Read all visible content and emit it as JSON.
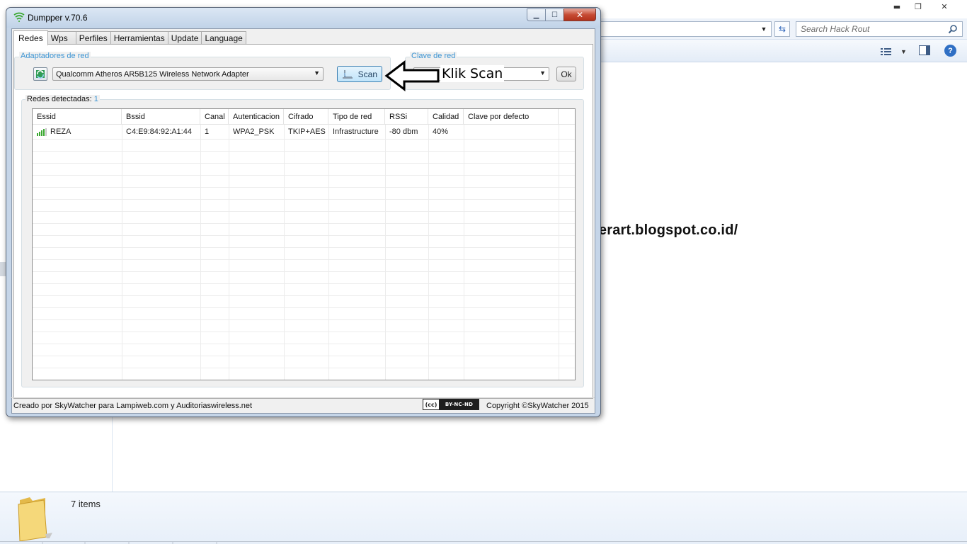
{
  "explorer": {
    "search_placeholder": "Search Hack Rout",
    "items_count": "7 items",
    "win_minimize": "▬",
    "win_restore": "❐",
    "win_close": "✕"
  },
  "watermark": "http://tkjcyberart.blogspot.co.id/",
  "dumpper": {
    "title": "Dumpper v.70.6",
    "tabs": [
      {
        "label": "Redes",
        "active": true
      },
      {
        "label": "Wps"
      },
      {
        "label": "Perfiles"
      },
      {
        "label": "Herramientas"
      },
      {
        "label": "Update"
      },
      {
        "label": "Language"
      }
    ],
    "adapters_group_label": "Adaptadores de red",
    "adapter_selected": "Qualcomm Atheros AR5B125 Wireless Network Adapter",
    "scan_label": "Scan",
    "clave_group_label": "Clave de red",
    "clave_selected": "",
    "ok_label": "Ok",
    "annotation": "Klik Scan",
    "redes_label": "Redes detectadas:",
    "redes_count": "1",
    "columns": [
      "Essid",
      "Bssid",
      "Canal",
      "Autenticacion",
      "Cifrado",
      "Tipo de red",
      "RSSi",
      "Calidad",
      "Clave por defecto"
    ],
    "rows": [
      {
        "essid": "REZA",
        "bssid": "C4:E9:84:92:A1:44",
        "canal": "1",
        "auth": "WPA2_PSK",
        "cifrado": "TKIP+AES",
        "tipo": "Infrastructure",
        "rssi": "-80 dbm",
        "calidad": "40%",
        "clave": ""
      }
    ],
    "status_left": "Creado por SkyWatcher para Lampiweb.com y Auditoriaswireless.net",
    "cc_left": "(cc)",
    "cc_right": "BY-NC-ND",
    "status_right": "Copyright ©SkyWatcher 2015"
  },
  "colors": {
    "accent_label": "#3d95d3",
    "signal_bars": "#3aa830"
  },
  "icons": [
    "wifi-icon",
    "network-adapter-icon",
    "scan-icon",
    "signal-strength-icon",
    "search-icon",
    "refresh-icon",
    "help-icon",
    "folder-icon",
    "arrow-left-annotation"
  ]
}
